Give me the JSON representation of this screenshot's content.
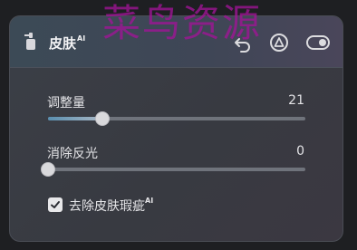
{
  "header": {
    "title": "皮肤",
    "title_badge": "AI",
    "watermark": "菜鸟资源",
    "icons": [
      "skin-tool-icon",
      "undo-icon",
      "triangle-warning-icon",
      "toggle-switch-icon"
    ]
  },
  "sliders": [
    {
      "label": "调整量",
      "value_text": "21",
      "value": 21,
      "min": 0,
      "max": 100
    },
    {
      "label": "消除反光",
      "value_text": "0",
      "value": 0,
      "min": 0,
      "max": 100
    }
  ],
  "checkbox": {
    "label": "去除皮肤瑕疵",
    "badge": "AI",
    "checked": true
  },
  "colors": {
    "accent_fill": "#5a8fb0",
    "watermark": "#a01496"
  }
}
